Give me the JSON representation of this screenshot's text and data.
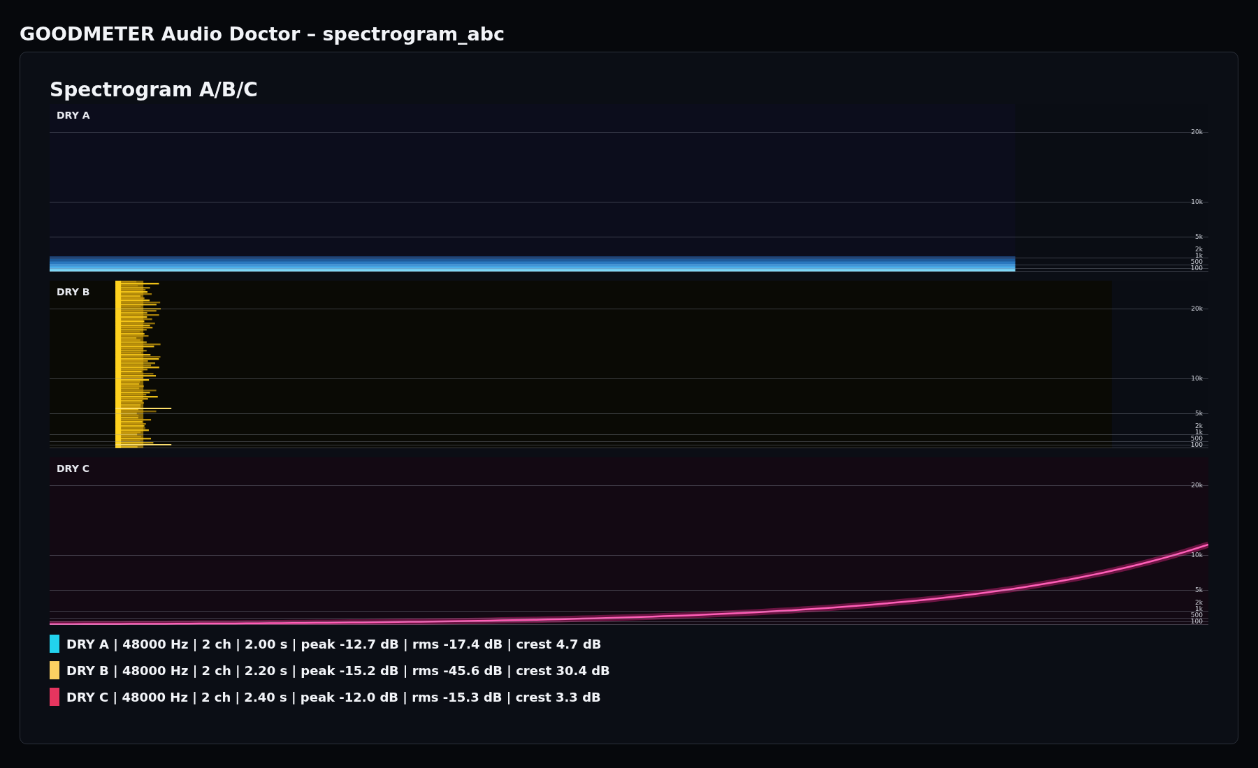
{
  "header": {
    "title": "GOODMETER Audio Doctor – spectrogram_abc"
  },
  "card": {
    "title": "Spectrogram A/B/C",
    "panels": [
      {
        "label": "DRY A",
        "kind": "tone",
        "ticks": [
          "20k",
          "10k",
          "5k",
          "2k",
          "1k",
          "500",
          "100"
        ]
      },
      {
        "label": "DRY B",
        "kind": "burst",
        "ticks": [
          "20k",
          "10k",
          "5k",
          "2k",
          "1k",
          "500",
          "100"
        ]
      },
      {
        "label": "DRY C",
        "kind": "sweep",
        "ticks": [
          "20k",
          "10k",
          "5k",
          "2k",
          "1k",
          "500",
          "100"
        ]
      }
    ],
    "legend": [
      {
        "text": "DRY A | 48000 Hz | 2 ch | 2.00 s | peak -12.7 dB | rms -17.4 dB | crest 4.7 dB",
        "color": "#22d3ee"
      },
      {
        "text": "DRY B | 48000 Hz | 2 ch | 2.20 s | peak -15.2 dB | rms -45.6 dB | crest 30.4 dB",
        "color": "#fcd062"
      },
      {
        "text": "DRY C | 48000 Hz | 2 ch | 2.40 s | peak -12.0 dB | rms -15.3 dB | crest 3.3 dB",
        "color": "#e6355f"
      }
    ]
  }
}
